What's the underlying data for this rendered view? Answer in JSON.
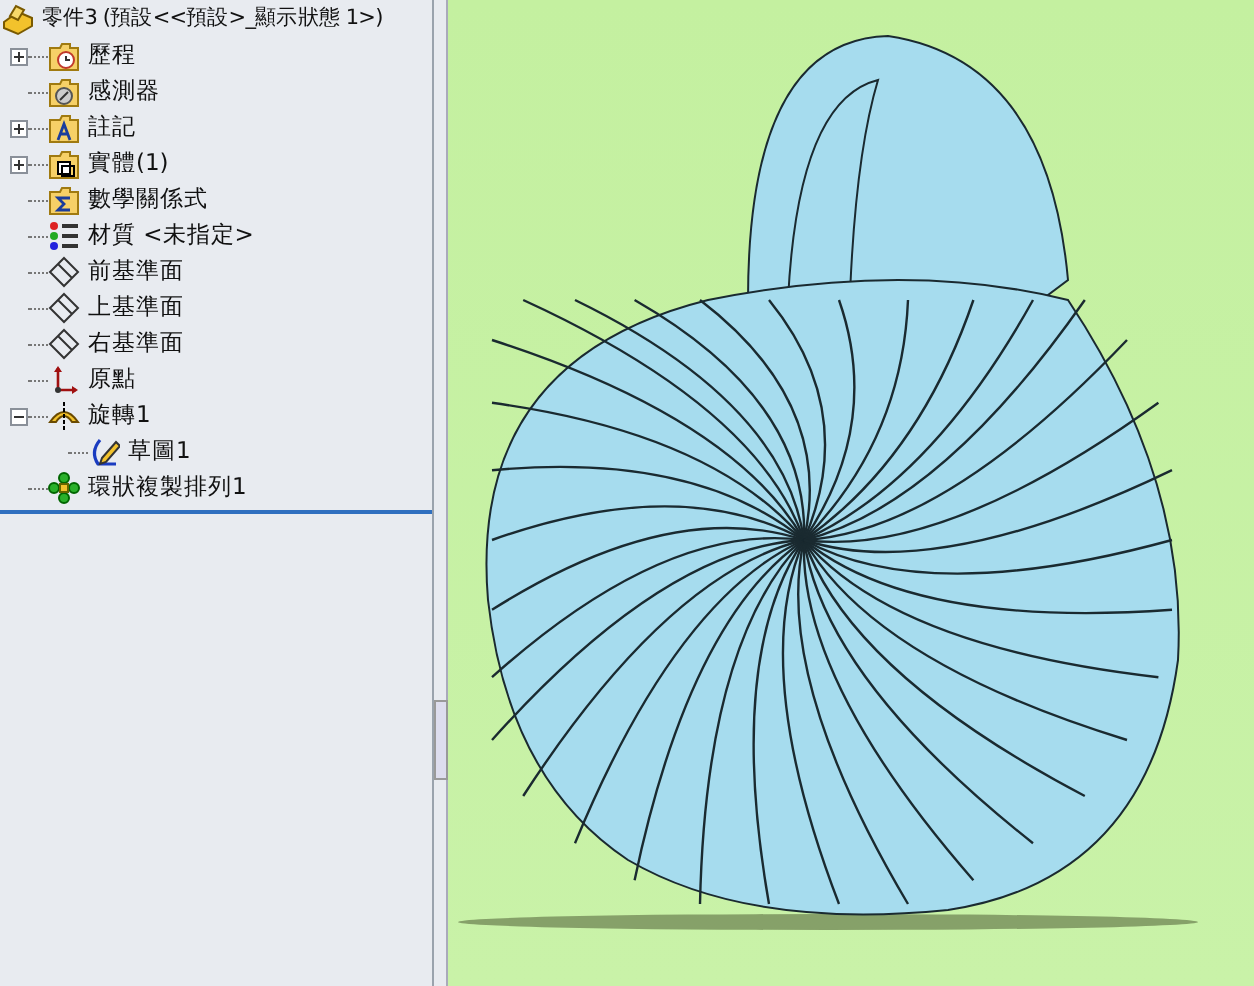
{
  "feature_tree": {
    "root": {
      "label": "零件3 (預設<<預設>_顯示狀態 1>)",
      "kind": "part"
    },
    "items": [
      {
        "label": "歷程",
        "kind": "history",
        "expanded": false
      },
      {
        "label": "感測器",
        "kind": "sensor"
      },
      {
        "label": "註記",
        "kind": "annotation",
        "expanded": false
      },
      {
        "label": "實體(1)",
        "kind": "body",
        "expanded": false
      },
      {
        "label": "數學關係式",
        "kind": "equation"
      },
      {
        "label": "材質 <未指定>",
        "kind": "material"
      },
      {
        "label": "前基準面",
        "kind": "plane"
      },
      {
        "label": "上基準面",
        "kind": "plane"
      },
      {
        "label": "右基準面",
        "kind": "plane"
      },
      {
        "label": "原點",
        "kind": "origin"
      },
      {
        "label": "旋轉1",
        "kind": "revolve",
        "expanded": true,
        "children": [
          {
            "label": "草圖1",
            "kind": "sketch"
          }
        ]
      },
      {
        "label": "環狀複製排列1",
        "kind": "pattern"
      }
    ]
  }
}
